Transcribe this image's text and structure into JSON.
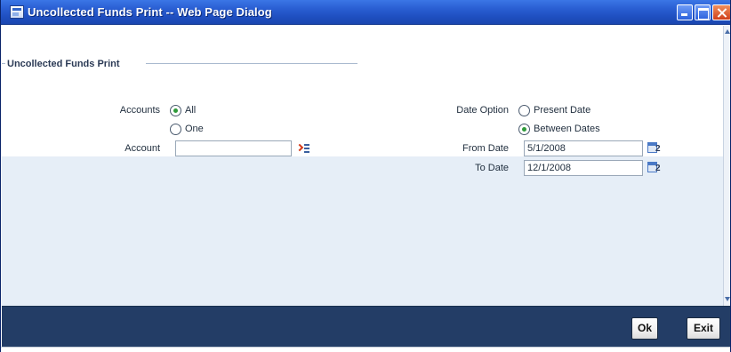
{
  "window": {
    "title": "Uncollected Funds Print -- Web Page Dialog"
  },
  "section": {
    "legend": "Uncollected Funds Print"
  },
  "accounts": {
    "label": "Accounts",
    "options": [
      "All",
      "One"
    ],
    "selected": "All"
  },
  "account": {
    "label": "Account",
    "value": ""
  },
  "date_option": {
    "label": "Date Option",
    "options": [
      "Present Date",
      "Between Dates"
    ],
    "selected": "Between Dates"
  },
  "from_date": {
    "label": "From Date",
    "value": "5/1/2008",
    "calendar_icon_text": "2"
  },
  "to_date": {
    "label": "To Date",
    "value": "12/1/2008",
    "calendar_icon_text": "2"
  },
  "footer": {
    "ok_label": "Ok",
    "exit_label": "Exit"
  },
  "colors": {
    "titlebar": "#2a5fd3",
    "footer": "#233d66",
    "lower_panel": "#e6eef7",
    "radio_checked": "#2f9a3a"
  },
  "icons": {
    "window": "dialog-window-icon",
    "minimize": "minimize-icon",
    "maximize": "maximize-icon",
    "close": "close-icon",
    "account_lookup": "list-of-values-icon",
    "from_date_picker": "calendar-icon",
    "to_date_picker": "calendar-icon"
  }
}
